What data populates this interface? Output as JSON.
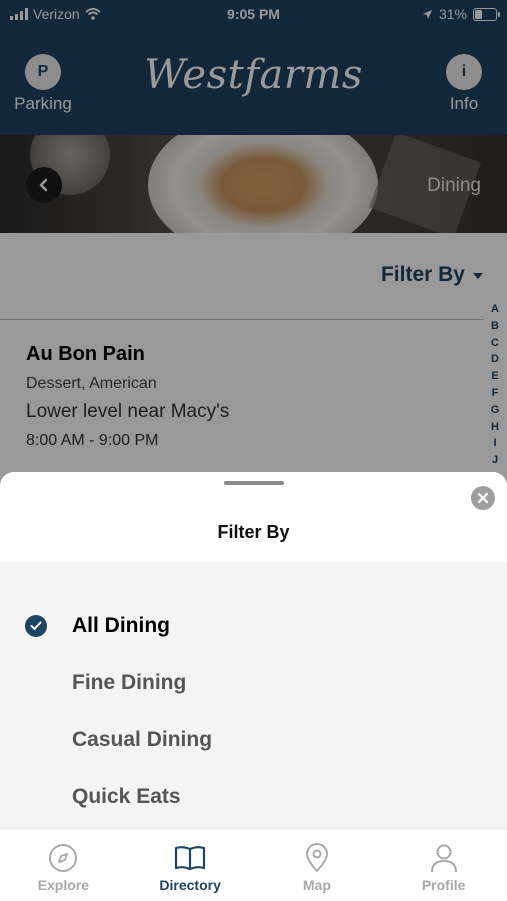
{
  "status_bar": {
    "carrier": "Verizon",
    "time": "9:05 PM",
    "battery": "31%"
  },
  "header": {
    "left_button": {
      "icon_letter": "P",
      "label": "Parking"
    },
    "title": "Westfarms",
    "right_button": {
      "icon_letter": "i",
      "label": "Info"
    }
  },
  "hero": {
    "label": "Dining"
  },
  "directory": {
    "filter_label": "Filter By",
    "alphabet": [
      "A",
      "B",
      "C",
      "D",
      "E",
      "F",
      "G",
      "H",
      "I",
      "J"
    ],
    "items": [
      {
        "name": "Au Bon Pain",
        "categories": "Dessert, American",
        "location": "Lower level near Macy's",
        "hours": "8:00 AM - 9:00 PM"
      }
    ]
  },
  "filter_sheet": {
    "title": "Filter By",
    "options": [
      {
        "label": "All Dining",
        "selected": true
      },
      {
        "label": "Fine Dining",
        "selected": false
      },
      {
        "label": "Casual Dining",
        "selected": false
      },
      {
        "label": "Quick Eats",
        "selected": false
      }
    ]
  },
  "tab_bar": {
    "tabs": [
      {
        "label": "Explore",
        "icon": "compass-icon",
        "active": false
      },
      {
        "label": "Directory",
        "icon": "book-icon",
        "active": true
      },
      {
        "label": "Map",
        "icon": "map-pin-icon",
        "active": false
      },
      {
        "label": "Profile",
        "icon": "person-icon",
        "active": false
      }
    ]
  },
  "colors": {
    "brand": "#1e4462",
    "inactive_tab": "#a9a9a9"
  }
}
